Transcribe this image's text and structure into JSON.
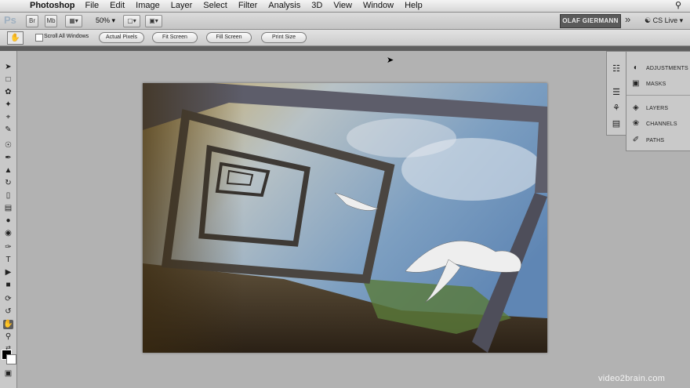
{
  "menubar": {
    "app_name": "Photoshop",
    "menus": [
      "File",
      "Edit",
      "Image",
      "Layer",
      "Select",
      "Filter",
      "Analysis",
      "3D",
      "View",
      "Window",
      "Help"
    ]
  },
  "appbar": {
    "logo": "Ps",
    "btn_br": "Br",
    "btn_mb": "Mb",
    "zoom": "50%",
    "user": "OLAF GIERMANN",
    "cs_live": "CS Live"
  },
  "options": {
    "scroll_all_windows": "Scroll All Windows",
    "actual_pixels": "Actual Pixels",
    "fit_screen": "Fit Screen",
    "fill_screen": "Fill Screen",
    "print_size": "Print Size"
  },
  "panels": {
    "adjustments": "ADJUSTMENTS",
    "masks": "MASKS",
    "layers": "LAYERS",
    "channels": "CHANNELS",
    "paths": "PATHS"
  },
  "watermark": "video2brain.com"
}
